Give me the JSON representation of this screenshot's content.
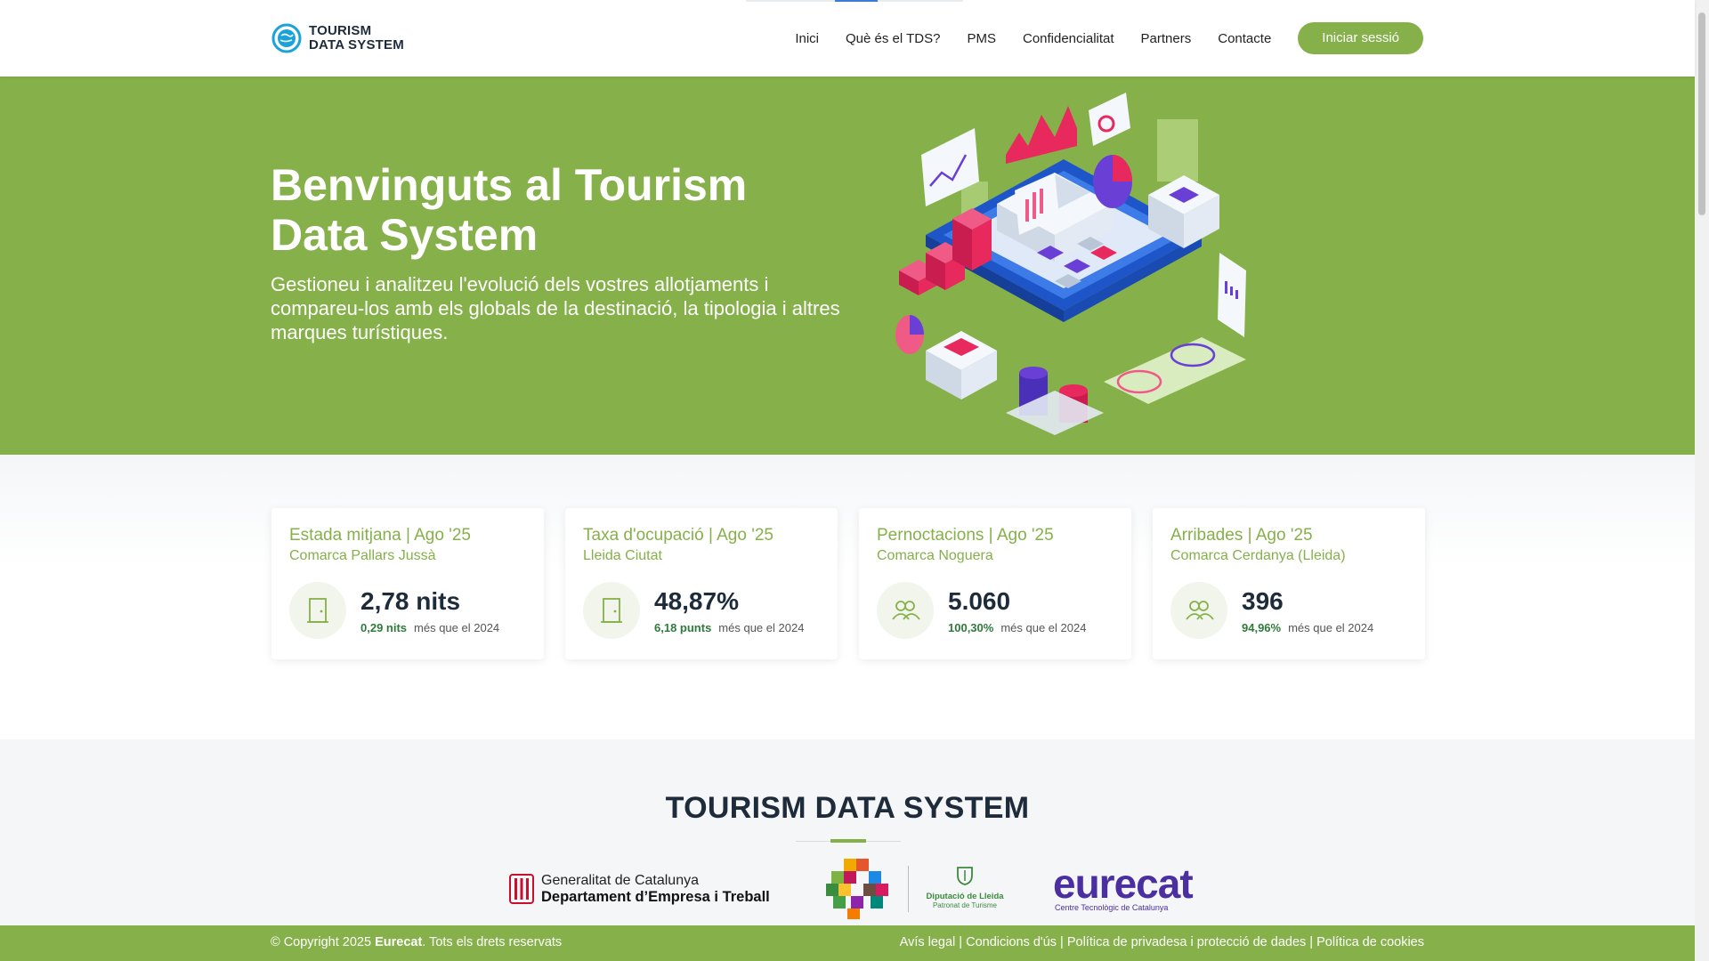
{
  "header": {
    "logo_line1": "TOURISM",
    "logo_line2": "DATA SYSTEM",
    "nav": [
      "Inici",
      "Què és el TDS?",
      "PMS",
      "Confidencialitat",
      "Partners",
      "Contacte"
    ],
    "login_label": "Iniciar sessió"
  },
  "hero": {
    "title": "Benvinguts al Tourism Data System",
    "subtitle": "Gestioneu i analitzeu l'evolució dels vostres allotjaments i compareu-los amb els globals de la destinació, la tipologia i altres marques turístiques."
  },
  "stats": [
    {
      "title": "Estada mitjana | Ago '25",
      "area": "Comarca Pallars Jussà",
      "value": "2,78 nits",
      "delta": "0,29 nits",
      "delta_text": "més que el 2024",
      "icon": "door-icon"
    },
    {
      "title": "Taxa d'ocupació | Ago '25",
      "area": "Lleida Ciutat",
      "value": "48,87%",
      "delta": "6,18 punts",
      "delta_text": "més que el 2024",
      "icon": "door-icon"
    },
    {
      "title": "Pernoctacions | Ago '25",
      "area": "Comarca Noguera",
      "value": "5.060",
      "delta": "100,30%",
      "delta_text": "més que el 2024",
      "icon": "people-icon"
    },
    {
      "title": "Arribades | Ago '25",
      "area": "Comarca Cerdanya (Lleida)",
      "value": "396",
      "delta": "94,96%",
      "delta_text": "més que el 2024",
      "icon": "people-icon"
    }
  ],
  "partners": {
    "title": "TOURISM DATA SYSTEM",
    "generalitat_line1": "Generalitat de Catalunya",
    "generalitat_line2": "Departament d’Empresa i Treball",
    "diputacio_line1": "Diputació de Lleida",
    "diputacio_line2": "Patronat de Turisme",
    "eurecat_name": "eurecat",
    "eurecat_sub": "Centre Tecnològic de Catalunya"
  },
  "footer": {
    "copyright_prefix": "© Copyright 2025",
    "company": "Eurecat",
    "copyright_suffix": ". Tots els drets reservats",
    "links": [
      "Avís legal",
      "Condicions d'ús",
      "Política de privadesa i protecció de dades",
      "Política de cookies"
    ]
  },
  "colors": {
    "brand_green": "#86b04a",
    "dark_text": "#1e2b3a",
    "delta_green": "#2f7a3b"
  }
}
